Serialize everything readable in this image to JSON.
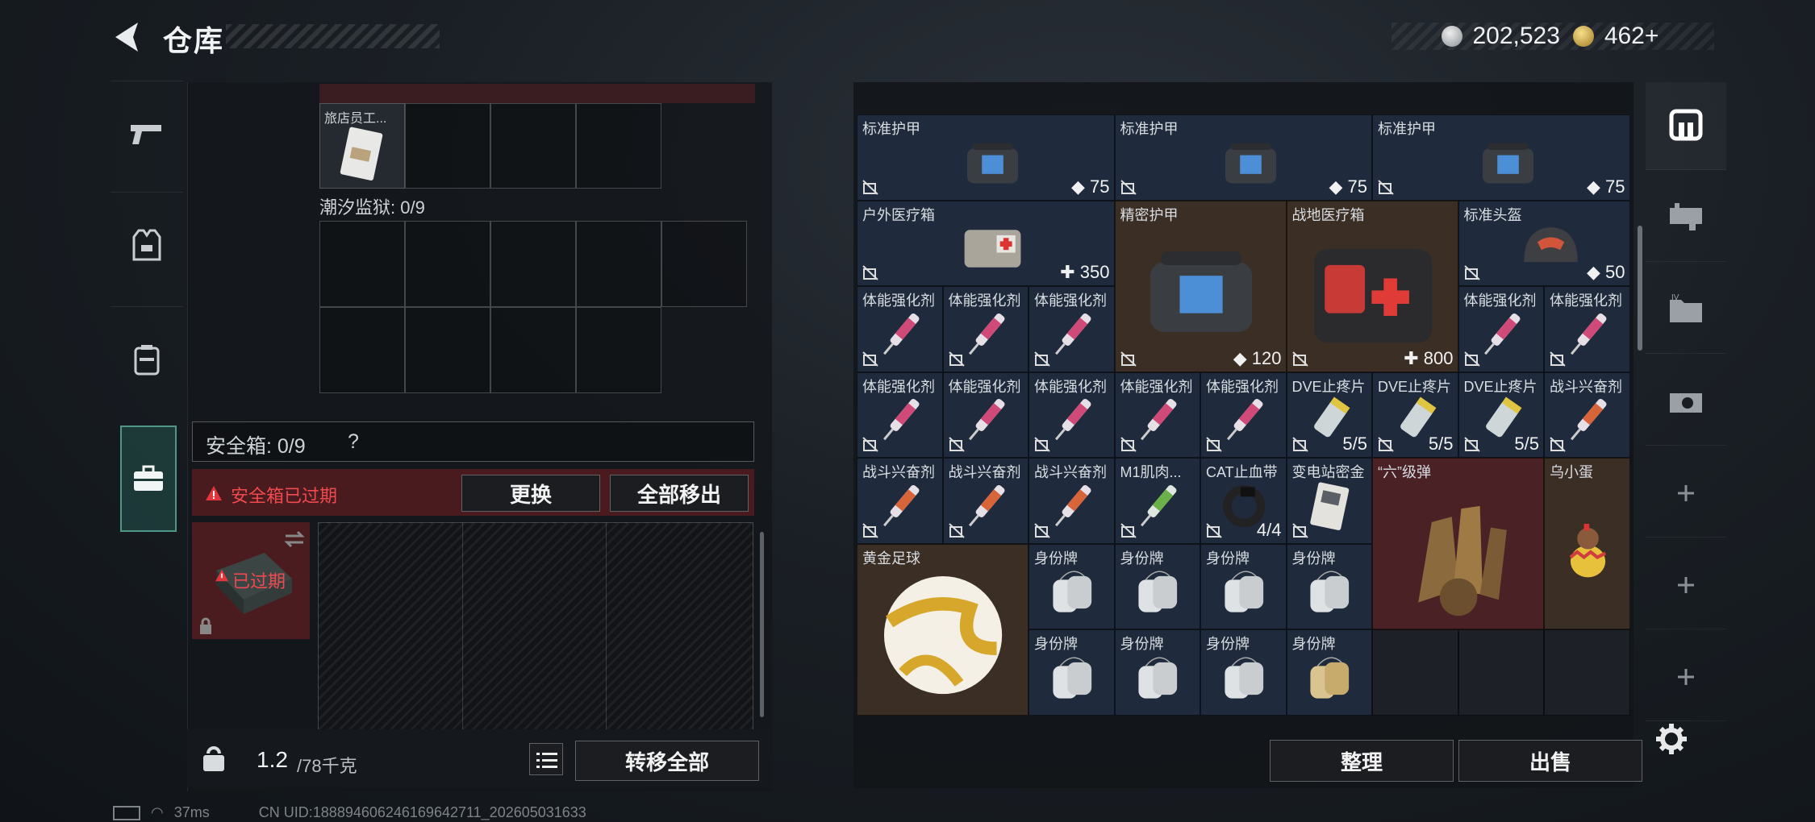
{
  "header": {
    "title": "仓库"
  },
  "currency": [
    {
      "icon": "silver-coin-icon",
      "value": "202,523"
    },
    {
      "icon": "gold-coin-icon",
      "value": "462+"
    }
  ],
  "left_tabs": [
    {
      "name": "weapons",
      "icon": "gun-icon"
    },
    {
      "name": "armor",
      "icon": "vest-icon"
    },
    {
      "name": "backpack",
      "icon": "backpack-icon"
    },
    {
      "name": "safe-box",
      "icon": "briefcase-icon",
      "active": true
    }
  ],
  "left_panel": {
    "top_item_name": "旅店员工...",
    "prison_label": "潮汐监狱: 0/9",
    "safe_label": "安全箱: 0/9",
    "safe_help": "?",
    "expired_text": "安全箱已过期",
    "replace_label": "更换",
    "move_all_out_label": "全部移出",
    "safe_item_expired": "已过期",
    "weight_value": "1.2",
    "weight_max": "/78千克",
    "transfer_all_label": "转移全部"
  },
  "inventory_top_row": [
    {
      "value": ""
    },
    {
      "value": ""
    },
    {
      "value": ""
    },
    {
      "value": "75"
    },
    {
      "value": "75"
    }
  ],
  "inventory": [
    {
      "name": "标准护甲",
      "value": "75",
      "tone": "c-blue",
      "kind": "armor"
    },
    {
      "name": "标准护甲",
      "value": "75",
      "tone": "c-blue",
      "kind": "armor"
    },
    {
      "name": "标准护甲",
      "value": "75",
      "tone": "c-blue",
      "kind": "armor"
    },
    {
      "name": "户外医疗箱",
      "value": "350",
      "tone": "c-blue",
      "kind": "medkit"
    },
    {
      "name": "精密护甲",
      "value": "120",
      "tone": "c-brown",
      "kind": "armor"
    },
    {
      "name": "战地医疗箱",
      "value": "800",
      "tone": "c-brown",
      "kind": "firstaid"
    },
    {
      "name": "标准头盔",
      "value": "50",
      "tone": "c-blue",
      "kind": "helmet"
    },
    {
      "name": "体能强化剂",
      "tone": "c-blue",
      "kind": "syringe-pink"
    },
    {
      "name": "体能强化剂",
      "tone": "c-blue",
      "kind": "syringe-pink"
    },
    {
      "name": "体能强化剂",
      "tone": "c-blue",
      "kind": "syringe-pink"
    },
    {
      "name": "体能强化剂",
      "tone": "c-blue",
      "kind": "syringe-pink"
    },
    {
      "name": "体能强化剂",
      "tone": "c-blue",
      "kind": "syringe-pink"
    },
    {
      "name": "体能强化剂",
      "tone": "c-blue",
      "kind": "syringe-pink"
    },
    {
      "name": "体能强化剂",
      "tone": "c-blue",
      "kind": "syringe-pink"
    },
    {
      "name": "体能强化剂",
      "tone": "c-blue",
      "kind": "syringe-pink"
    },
    {
      "name": "体能强化剂",
      "tone": "c-blue",
      "kind": "syringe-pink"
    },
    {
      "name": "体能强化剂",
      "tone": "c-blue",
      "kind": "syringe-pink"
    },
    {
      "name": "DVE止疼片",
      "value": "5/5",
      "tone": "c-blue",
      "kind": "pills"
    },
    {
      "name": "DVE止疼片",
      "value": "5/5",
      "tone": "c-blue",
      "kind": "pills"
    },
    {
      "name": "DVE止疼片",
      "value": "5/5",
      "tone": "c-blue",
      "kind": "pills"
    },
    {
      "name": "战斗兴奋剂",
      "tone": "c-blue",
      "kind": "syringe-orange"
    },
    {
      "name": "战斗兴奋剂",
      "tone": "c-blue",
      "kind": "syringe-orange"
    },
    {
      "name": "战斗兴奋剂",
      "tone": "c-blue",
      "kind": "syringe-orange"
    },
    {
      "name": "战斗兴奋剂",
      "tone": "c-blue",
      "kind": "syringe-orange"
    },
    {
      "name": "M1肌肉...",
      "tone": "c-blue",
      "kind": "syringe-green"
    },
    {
      "name": "CAT止血带",
      "value": "4/4",
      "tone": "c-blue",
      "kind": "tourniquet"
    },
    {
      "name": "变电站密金",
      "tone": "c-blue",
      "kind": "card"
    },
    {
      "name": "“六”级弹",
      "tone": "c-red",
      "kind": "bullets"
    },
    {
      "name": "乌小蛋",
      "tone": "c-brown",
      "kind": "egg"
    },
    {
      "name": "黄金足球",
      "tone": "c-brown",
      "kind": "football"
    },
    {
      "name": "身份牌",
      "tone": "c-blue",
      "kind": "dogtag"
    },
    {
      "name": "身份牌",
      "tone": "c-blue",
      "kind": "dogtag"
    },
    {
      "name": "身份牌",
      "tone": "c-blue",
      "kind": "dogtag"
    },
    {
      "name": "身份牌",
      "tone": "c-blue",
      "kind": "dogtag"
    },
    {
      "name": "身份牌",
      "tone": "c-blue",
      "kind": "dogtag"
    },
    {
      "name": "身份牌",
      "tone": "c-blue",
      "kind": "dogtag"
    },
    {
      "name": "身份牌",
      "tone": "c-blue",
      "kind": "dogtag"
    },
    {
      "name": "身份牌",
      "tone": "c-blue",
      "kind": "dogtag-gold"
    }
  ],
  "right_tabs": [
    {
      "icon": "storage-icon",
      "active": true
    },
    {
      "icon": "rifle-case-icon"
    },
    {
      "icon": "folder-iv-icon"
    },
    {
      "icon": "camera-case-icon"
    },
    {
      "icon": "plus-icon"
    },
    {
      "icon": "plus-icon"
    },
    {
      "icon": "plus-icon"
    }
  ],
  "footer": {
    "organize_label": "整理",
    "sell_label": "出售"
  },
  "status": {
    "ping": "37ms",
    "uid": "CN UID:188894606246169642711_202605031633"
  },
  "colors": {
    "accent": "#6fe0c8",
    "expired_red": "#e2363c",
    "cell_blue": "#1f2b3d",
    "cell_brown": "#3b2e25",
    "cell_red": "#4a2226"
  }
}
